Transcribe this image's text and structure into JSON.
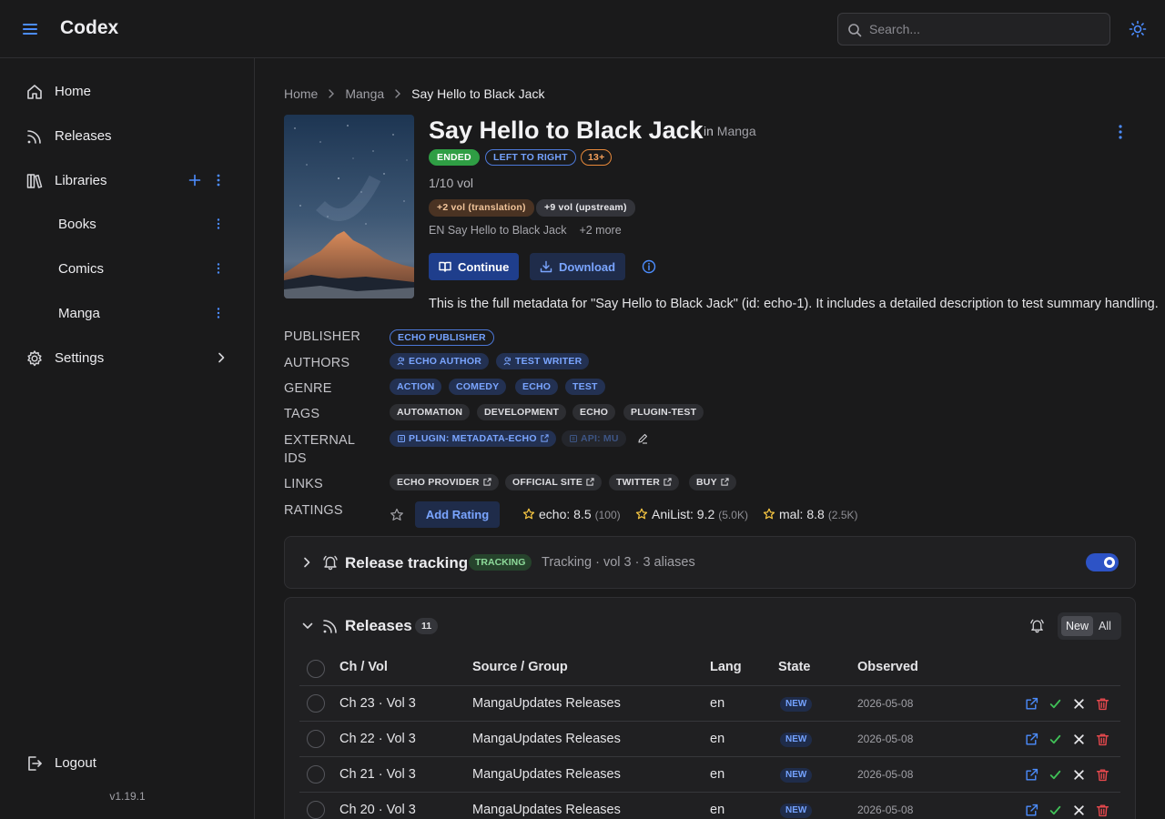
{
  "app": {
    "name": "Codex",
    "version": "v1.19.1"
  },
  "search": {
    "placeholder": "Search..."
  },
  "sidebar": {
    "items": [
      {
        "label": "Home",
        "icon": "home-icon"
      },
      {
        "label": "Releases",
        "icon": "rss-icon"
      },
      {
        "label": "Libraries",
        "icon": "library-icon"
      },
      {
        "label": "Books"
      },
      {
        "label": "Comics"
      },
      {
        "label": "Manga"
      },
      {
        "label": "Settings",
        "icon": "gear-icon"
      }
    ],
    "logout": "Logout"
  },
  "breadcrumb": [
    "Home",
    "Manga",
    "Say Hello to Black Jack"
  ],
  "series": {
    "title": "Say Hello to Black Jack",
    "in_label": "in",
    "library": "Manga",
    "badges": {
      "status": "ENDED",
      "direction": "LEFT TO RIGHT",
      "age": "13+"
    },
    "volumes": "1/10 vol",
    "vol_badges": {
      "translation": "+2 vol (translation)",
      "upstream": "+9 vol (upstream)"
    },
    "alt_title": "EN Say Hello to Black Jack",
    "alt_more": "+2 more",
    "actions": {
      "continue": "Continue",
      "download": "Download"
    },
    "summary": "This is the full metadata for \"Say Hello to Black Jack\" (id: echo-1). It includes a detailed description to test summary handling."
  },
  "metadata": {
    "labels": {
      "publisher": "PUBLISHER",
      "authors": "AUTHORS",
      "genre": "GENRE",
      "tags": "TAGS",
      "external_ids_1": "EXTERNAL",
      "external_ids_2": "IDS",
      "links": "LINKS",
      "ratings": "RATINGS"
    },
    "publisher": "ECHO PUBLISHER",
    "authors": [
      "ECHO AUTHOR",
      "TEST WRITER"
    ],
    "genres": [
      "ACTION",
      "COMEDY",
      "ECHO",
      "TEST"
    ],
    "tags": [
      "AUTOMATION",
      "DEVELOPMENT",
      "ECHO",
      "PLUGIN-TEST"
    ],
    "external_ids": [
      "PLUGIN: METADATA-ECHO",
      "API: MU"
    ],
    "links": [
      "ECHO PROVIDER",
      "OFFICIAL SITE",
      "TWITTER",
      "BUY"
    ],
    "add_rating": "Add Rating",
    "ratings": [
      {
        "source": "echo: 8.5",
        "count": "(100)"
      },
      {
        "source": "AniList: 9.2",
        "count": "(5.0K)"
      },
      {
        "source": "mal: 8.8",
        "count": "(2.5K)"
      }
    ]
  },
  "tracking": {
    "title": "Release tracking",
    "badge": "TRACKING",
    "subtitle": "Tracking · vol 3 · 3 aliases",
    "enabled": true
  },
  "releases": {
    "title": "Releases",
    "count": "11",
    "filter": {
      "new": "New",
      "all": "All",
      "selected": "New"
    },
    "columns": {
      "chvol": "Ch / Vol",
      "source": "Source / Group",
      "lang": "Lang",
      "state": "State",
      "observed": "Observed"
    },
    "rows": [
      {
        "chvol": "Ch 23 · Vol 3",
        "source": "MangaUpdates Releases",
        "lang": "en",
        "state": "NEW",
        "observed": "2026-05-08"
      },
      {
        "chvol": "Ch 22 · Vol 3",
        "source": "MangaUpdates Releases",
        "lang": "en",
        "state": "NEW",
        "observed": "2026-05-08"
      },
      {
        "chvol": "Ch 21 · Vol 3",
        "source": "MangaUpdates Releases",
        "lang": "en",
        "state": "NEW",
        "observed": "2026-05-08"
      },
      {
        "chvol": "Ch 20 · Vol 3",
        "source": "MangaUpdates Releases",
        "lang": "en",
        "state": "NEW",
        "observed": "2026-05-08"
      }
    ]
  },
  "colors": {
    "accent": "#4c78d8",
    "success": "#2f9e44",
    "danger": "#e5484d",
    "background": "#1a1a1b"
  }
}
